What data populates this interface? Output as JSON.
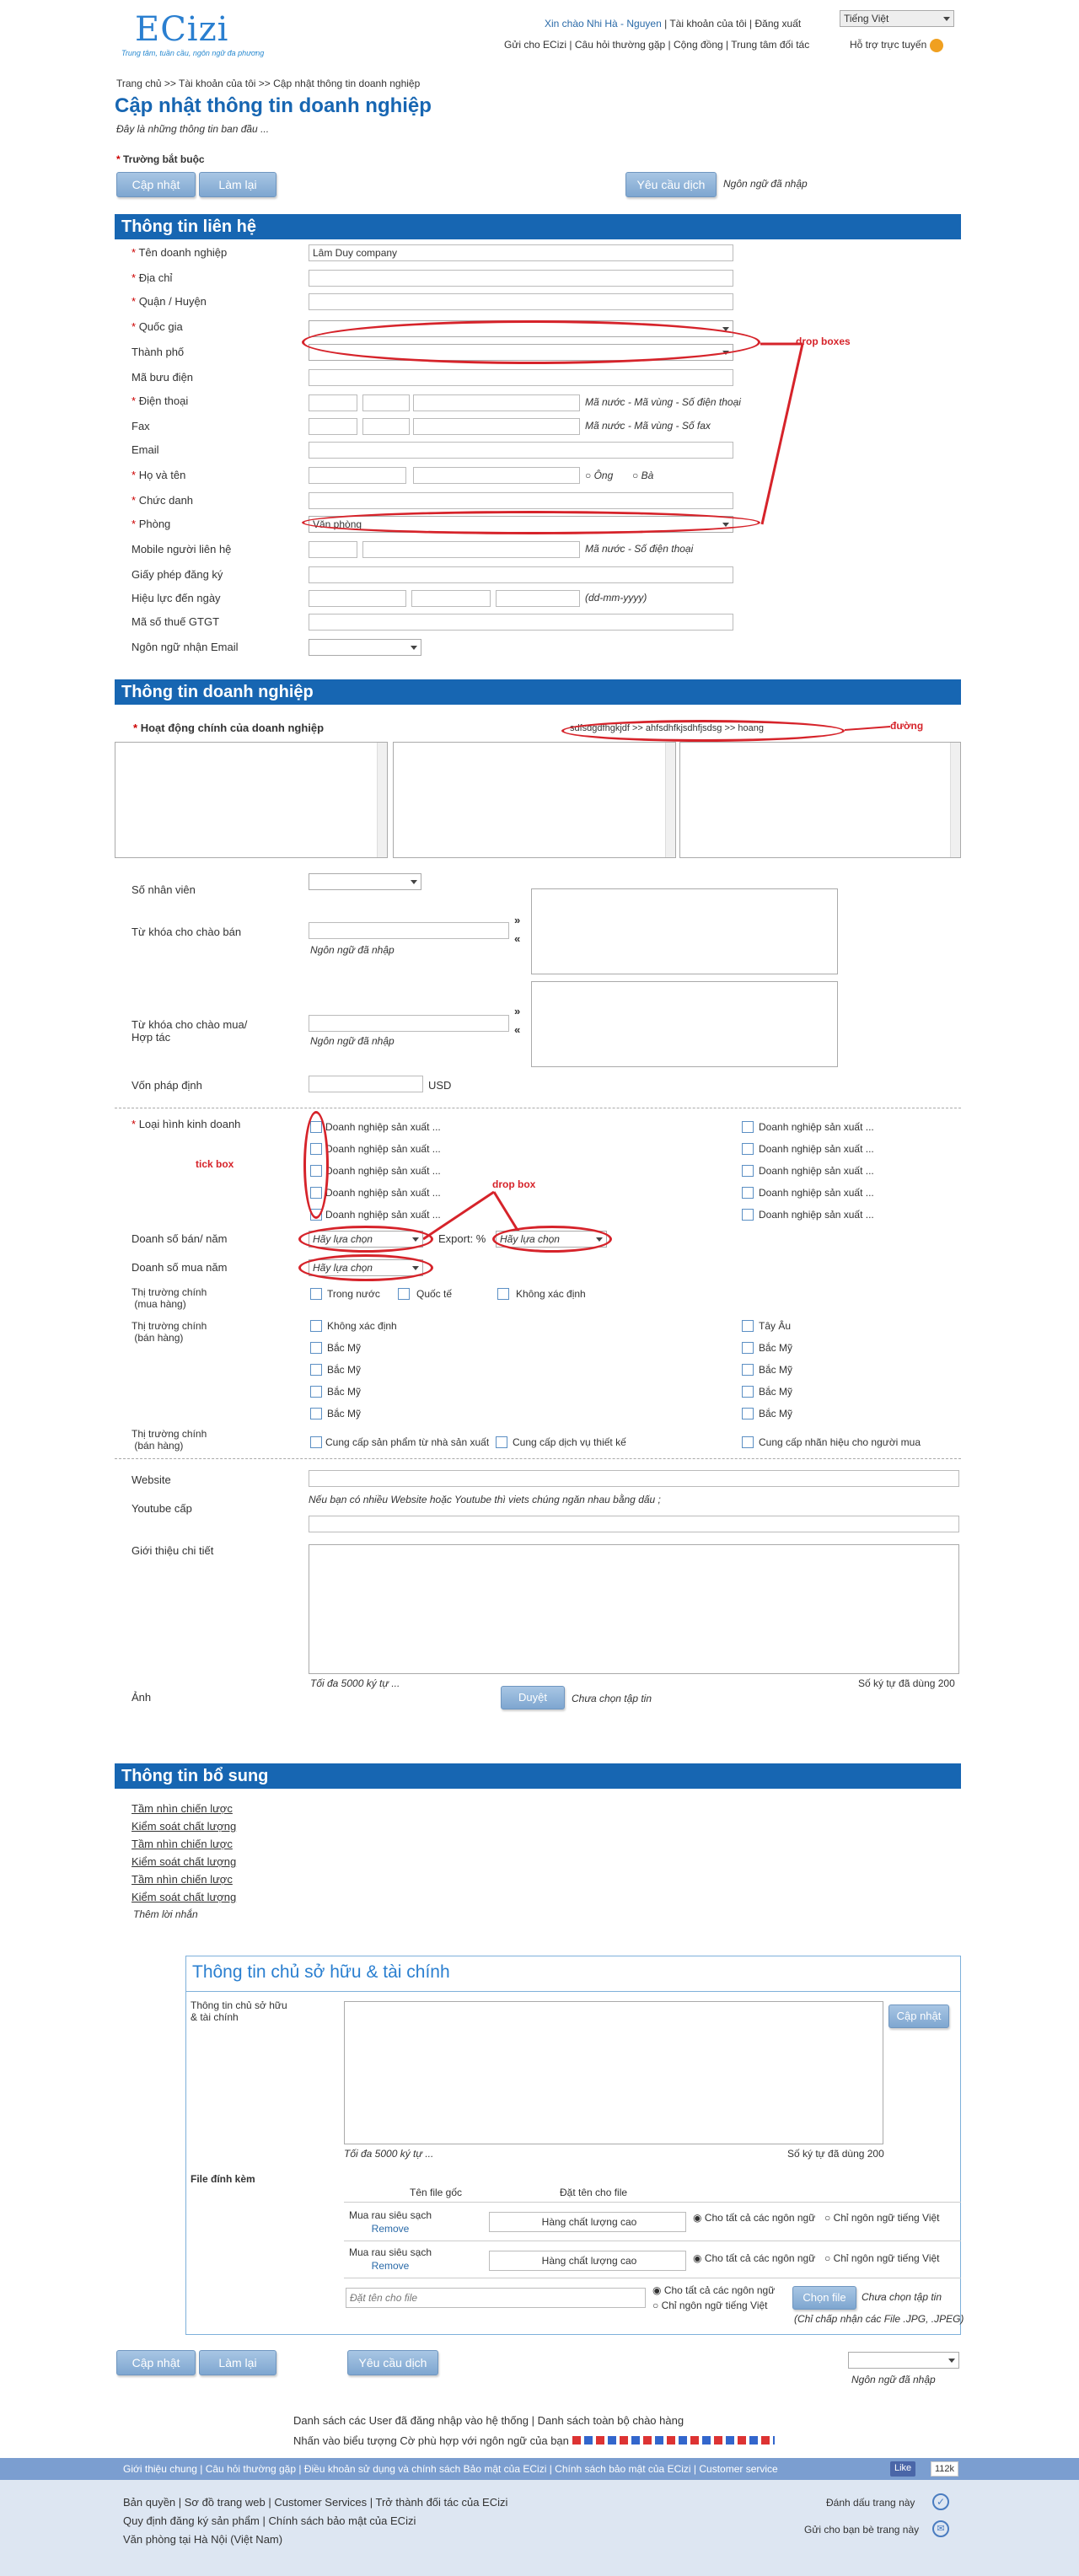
{
  "header": {
    "logo": "ECizi",
    "tagline": "Trung tâm, tuần cầu, ngôn ngữ đa phương",
    "greeting": "Xin chào Nhi Hà - Nguyen",
    "my_account": "Tài khoản của tôi",
    "logout": "Đăng xuất",
    "lang": "Tiếng Việt",
    "nav": [
      "Gửi cho ECizi",
      "Câu hỏi thường gặp",
      "Cộng đồng",
      "Trung tâm đối tác"
    ],
    "support": "Hỗ trợ trực tuyến"
  },
  "breadcrumb": "Trang chủ >> Tài khoản của tôi >> Cập nhật thông tin doanh nghiệp",
  "page": {
    "title": "Cập nhật thông tin doanh nghiệp",
    "subtitle": "Đây là những thông tin ban đầu ...",
    "required": "Trường bắt buộc",
    "update": "Cập nhật",
    "reset": "Làm lại",
    "translate": "Yêu cầu dịch",
    "lang_entered": "Ngôn ngữ đã nhập"
  },
  "contact": {
    "title": "Thông tin liên hệ",
    "labels": {
      "company": "Tên doanh nghiệp",
      "address": "Địa chỉ",
      "district": "Quận / Huyện",
      "country": "Quốc gia",
      "city": "Thành phố",
      "postal": "Mã bưu điện",
      "phone": "Điện thoại",
      "fax": "Fax",
      "email": "Email",
      "name": "Họ và tên",
      "position": "Chức danh",
      "department": "Phòng",
      "mobile": "Mobile người liên hệ",
      "license": "Giấy phép đăng ký",
      "valid": "Hiệu lực đến ngày",
      "tax": "Mã số thuế GTGT",
      "email_lang": "Ngôn ngữ nhận Email"
    },
    "company_value": "Lâm Duy company",
    "phone_hint": "Mã nước - Mã vùng - Số điện thoại",
    "fax_hint": "Mã nước - Mã vùng - Số fax",
    "mr": "Ông",
    "ms": "Bà",
    "dept_value": "Văn phòng",
    "mobile_hint": "Mã nước - Số điện thoại",
    "date_hint": "(dd-mm-yyyy)",
    "note_drop": "drop boxes"
  },
  "business": {
    "title": "Thông tin doanh nghiệp",
    "main_activity": "Hoạt động chính của doanh nghiệp",
    "path": "sdfsdgdfhgkjdf >> ahfsdhfkjsdhfjsdsg >> hoang",
    "note_path": "đường",
    "employees": "Số nhân viên",
    "kw_sell": "Từ khóa cho chào bán",
    "kw_buy1": "Từ khóa cho chào mua/",
    "kw_buy2": "Hợp tác",
    "capital": "Vốn pháp định",
    "usd": "USD",
    "biz_type": "Loại hình kinh doanh",
    "biz_item": "Doanh nghiệp sản xuất ...",
    "note_tick": "tick box",
    "note_drop": "drop box",
    "sales": "Doanh số bán/ năm",
    "export": "Export: %",
    "choose": "Hãy lựa chọn",
    "purchase": "Doanh số mua năm",
    "mkt_buy1": "Thị trường chính",
    "mkt_buy2": "(mua hàng)",
    "mkt_sell2": "(bán hàng)",
    "domestic": "Trong nước",
    "international": "Quốc tế",
    "undefined": "Không xác định",
    "west_eu": "Tây Âu",
    "na": "Bắc Mỹ",
    "supply1": "Cung cấp sản phẩm từ nhà sản xuất",
    "supply2": "Cung cấp dịch vụ thiết kế",
    "supply3": "Cung cấp nhãn hiệu cho người mua",
    "website": "Website",
    "youtube": "Youtube cấp",
    "yt_hint": "Nếu bạn có nhiều Website hoặc Youtube thì viets chúng ngăn nhau bằng dấu ;",
    "intro": "Giới thiệu chi tiết",
    "max": "Tối đa 5000 ký tự ...",
    "used": "Số ký tự đã dùng 200",
    "photo": "Ảnh",
    "browse": "Duyệt",
    "no_file": "Chưa chọn tập tin"
  },
  "extra": {
    "title": "Thông tin bổ sung",
    "links": [
      "Tầm nhìn chiến lược",
      "Kiểm soát chất lượng",
      "Tầm nhìn chiến lược",
      "Kiểm soát chất lượng",
      "Tầm nhìn chiến lược",
      "Kiểm soát chất lượng"
    ],
    "more": "Thêm lời nhắn"
  },
  "owner": {
    "title": "Thông tin chủ sở hữu & tài chính",
    "label1": "Thông tin chủ sở hữu",
    "label2": "& tài chính",
    "update": "Cập nhật",
    "max": "Tối đa 5000 ký tự ...",
    "used": "Số ký tự đã dùng 200",
    "attach": "File đính kèm",
    "col1": "Tên file gốc",
    "col2": "Đặt tên cho file",
    "file1a": "Mua rau siêu sạch",
    "file1b": "Remove",
    "file_name": "Hàng chất lượng cao",
    "all_lang": "Cho tất cả các ngôn ngữ",
    "vn_only": "Chỉ ngôn ngữ tiếng Việt",
    "placeholder": "Đặt tên cho file",
    "choose_file": "Chọn file",
    "no_file": "Chưa chọn tập tin",
    "accept": "(Chỉ chấp nhận các File .JPG, .JPEG)"
  },
  "bottom": {
    "update": "Cập nhật",
    "reset": "Làm lại",
    "translate": "Yêu cầu dịch",
    "lang_entered": "Ngôn ngữ đã nhập",
    "list1": "Danh sách các User đã đăng nhập vào hệ thống",
    "list2": "Danh sách toàn bộ chào hàng",
    "emblem": "Nhấn vào biểu tượng Cờ phù hợp với ngôn ngữ của bạn"
  },
  "footer": {
    "links": [
      "Giới thiệu chung",
      "Câu hỏi thường gặp",
      "Điều khoản sử dụng và chính sách Bảo mật của ECizi",
      "Chính sách bảo mật của ECizi",
      "Customer service"
    ],
    "like": "Like",
    "likes": "112k",
    "rows": [
      "Bản quyền | Sơ đồ trang web | Customer Services | Trở thành đối tác của ECizi",
      "Quy định đăng ký sản phẩm | Chính sách bảo mật của ECizi",
      "Văn phòng tại Hà Nội (Việt Nam)"
    ],
    "bookmark": "Đánh dấu trang này",
    "send": "Gửi cho bạn bè trang này"
  }
}
